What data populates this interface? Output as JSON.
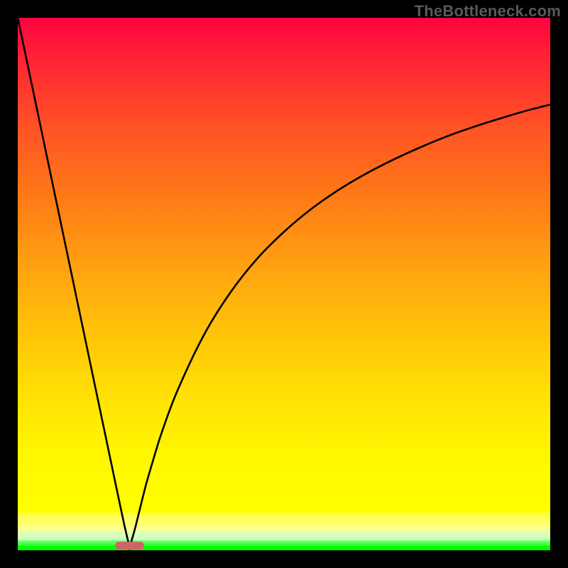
{
  "watermark": "TheBottleneck.com",
  "colors": {
    "frame": "#000000",
    "curve": "#000000",
    "marker": "#cc6666",
    "gradient_top": "#ff0240",
    "gradient_bottom": "#00ff00"
  },
  "chart_data": {
    "type": "line",
    "title": "",
    "xlabel": "",
    "ylabel": "",
    "xlim": [
      0,
      100
    ],
    "ylim": [
      0,
      100
    ],
    "grid": false,
    "legend": false,
    "annotations": [],
    "description": "Bottleneck-style curve: a steep linear descent from top-left to a near-zero minimum around x≈21, then a concave rise approaching ~85 at the right edge. Background is a vertical gradient from red (top) through orange/yellow to green (bottom). A small rounded marker sits at the curve minimum near the baseline.",
    "series": [
      {
        "name": "curve",
        "x": [
          0,
          2,
          5,
          8,
          11,
          14,
          17,
          19,
          20,
          21,
          22,
          23,
          24,
          25,
          27,
          30,
          35,
          40,
          45,
          50,
          55,
          60,
          65,
          70,
          75,
          80,
          85,
          90,
          95,
          100
        ],
        "y": [
          100,
          90.5,
          76.2,
          61.9,
          47.6,
          33.3,
          19.0,
          9.5,
          4.8,
          0.5,
          4.0,
          8.0,
          12.0,
          15.5,
          22.0,
          30.0,
          40.5,
          48.5,
          54.8,
          59.8,
          64.0,
          67.5,
          70.5,
          73.1,
          75.4,
          77.5,
          79.3,
          80.9,
          82.4,
          83.7
        ]
      }
    ],
    "marker": {
      "x": 21,
      "y": 0.5,
      "width_pct": 5.5
    }
  }
}
